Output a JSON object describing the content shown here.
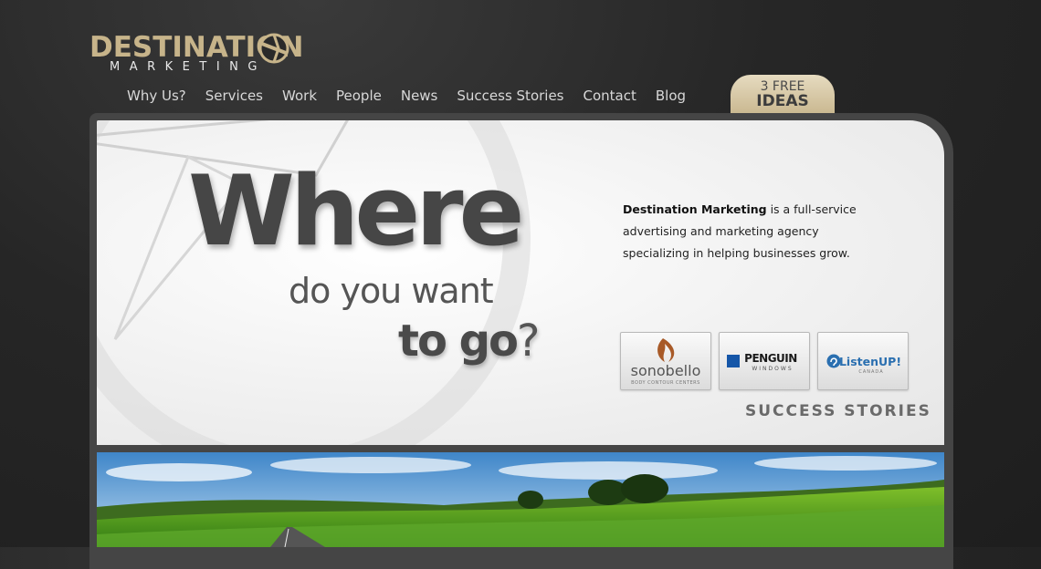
{
  "logo": {
    "word": "DESTINATION",
    "sub": "MARKETING"
  },
  "nav": {
    "items": [
      "Why Us?",
      "Services",
      "Work",
      "People",
      "News",
      "Success Stories",
      "Contact",
      "Blog"
    ]
  },
  "ideas_tab": {
    "line1": "3 FREE",
    "line2": "IDEAS"
  },
  "hero": {
    "headline_where": "Where",
    "headline_want": "do you want",
    "headline_go": "to go",
    "headline_q": "?",
    "intro_bold": "Destination Marketing",
    "intro_text": " is a full-service advertising and marketing agency specializing in helping businesses grow."
  },
  "clients": [
    {
      "name": "sonobello",
      "sub": "BODY CONTOUR CENTERS"
    },
    {
      "name": "PENGUIN",
      "sub": "WINDOWS"
    },
    {
      "name": "ListenUP!",
      "sub": "CANADA"
    }
  ],
  "success_caption": "SUCCESS STORIES",
  "colors": {
    "gold": "#c7b48a",
    "dark_bg": "#262626",
    "frame": "#454545",
    "listen_blue": "#2a6fb0",
    "penguin_blue": "#1556a8"
  }
}
